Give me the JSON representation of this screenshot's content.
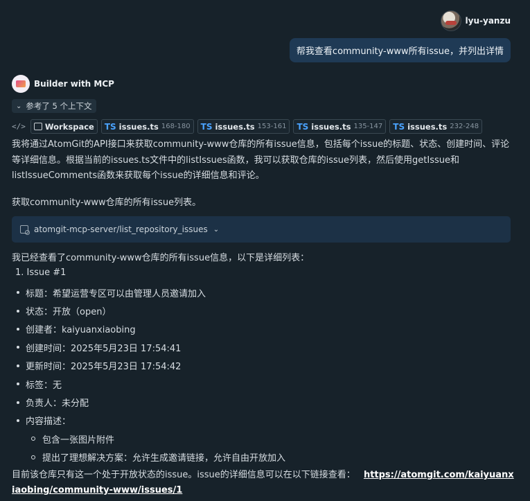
{
  "user": {
    "name": "lyu-yanzu",
    "message": "帮我查看community-www所有issue，并列出详情"
  },
  "assistant": {
    "name": "Builder with MCP",
    "context_toggle": "参考了 5 个上下文",
    "context_files": [
      {
        "type": "workspace",
        "label": "Workspace"
      },
      {
        "type": "file",
        "lang": "TS",
        "name": "issues.ts",
        "range": "168-180"
      },
      {
        "type": "file",
        "lang": "TS",
        "name": "issues.ts",
        "range": "153-161"
      },
      {
        "type": "file",
        "lang": "TS",
        "name": "issues.ts",
        "range": "135-147"
      },
      {
        "type": "file",
        "lang": "TS",
        "name": "issues.ts",
        "range": "232-248"
      }
    ],
    "intro": "我将通过AtomGit的API接口来获取community-www仓库的所有issue信息，包括每个issue的标题、状态、创建时间、评论等详细信息。根据当前的issues.ts文件中的listIssues函数，我可以获取仓库的issue列表，然后使用getIssue和listIssueComments函数来获取每个issue的详细信息和评论。",
    "step": "获取community-www仓库的所有issue列表。",
    "tool_call": "atomgit-mcp-server/list_repository_issues",
    "result_intro": "我已经查看了community-www仓库的所有issue信息，以下是详细列表：",
    "issue_heading": "1. Issue #1",
    "details": [
      "标题：希望运营专区可以由管理人员邀请加入",
      "状态：开放（open）",
      "创建者：kaiyuanxiaobing",
      "创建时间：2025年5月23日 17:54:41",
      "更新时间：2025年5月23日 17:54:42",
      "标签：无",
      "负责人：未分配",
      "内容描述："
    ],
    "description_items": [
      "包含一张图片附件",
      "提出了理想解决方案：允许生成邀请链接，允许自由开放加入"
    ],
    "final_text": "目前该仓库只有这一个处于开放状态的issue。issue的详细信息可以在以下链接查看：",
    "link": "https://atomgit.com/kaiyuanxiaobing/community-www/issues/1"
  },
  "colors": {
    "background": "#17222a",
    "user_bubble": "#1f3a55",
    "tool_card": "#1c3146",
    "ts_badge": "#4aa3ff"
  },
  "icons": [
    "user-avatar",
    "bot-avatar",
    "chevron-down-icon",
    "code-icon",
    "workspace-icon",
    "tool-icon"
  ]
}
